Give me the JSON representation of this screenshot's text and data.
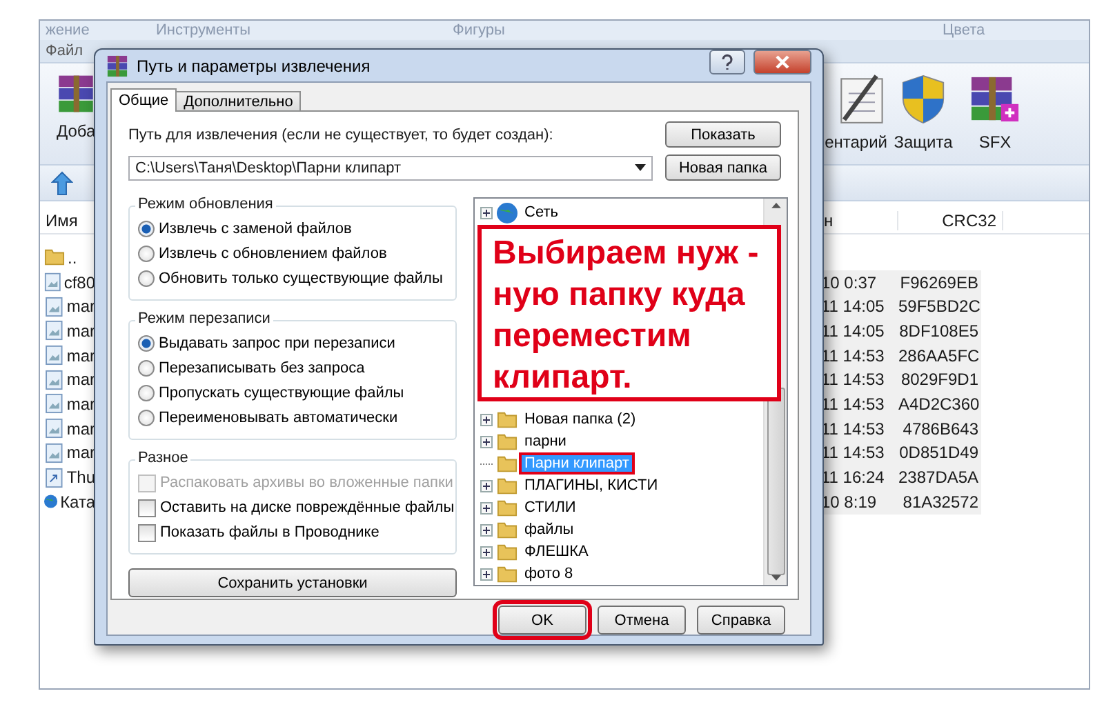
{
  "ribbon_groups": [
    "жение",
    "Инструменты",
    "Фигуры",
    "Цвета"
  ],
  "menu": [
    "Файл"
  ],
  "toolbar": [
    {
      "kind": "archive",
      "label": "Доба"
    },
    {
      "kind": "comment",
      "label": "ентарий"
    },
    {
      "kind": "shield",
      "label": "Защита"
    },
    {
      "kind": "sfx",
      "label": "SFX"
    }
  ],
  "file_list": {
    "columns": [
      "Имя",
      "н",
      "CRC32"
    ],
    "rows": [
      {
        "kind": "folder",
        "name": ".."
      },
      {
        "kind": "image",
        "name": "cf80",
        "modified": "10 0:37",
        "crc": "F96269EB"
      },
      {
        "kind": "image",
        "name": "mar",
        "modified": "11 14:05",
        "crc": "59F5BD2C"
      },
      {
        "kind": "image",
        "name": "mar",
        "modified": "11 14:05",
        "crc": "8DF108E5"
      },
      {
        "kind": "image",
        "name": "mar",
        "modified": "11 14:53",
        "crc": "286AA5FC"
      },
      {
        "kind": "image",
        "name": "mar",
        "modified": "11 14:53",
        "crc": "8029F9D1"
      },
      {
        "kind": "image",
        "name": "mar",
        "modified": "11 14:53",
        "crc": "A4D2C360"
      },
      {
        "kind": "image",
        "name": "mar",
        "modified": "11 14:53",
        "crc": "4786B643"
      },
      {
        "kind": "image",
        "name": "mar",
        "modified": "11 14:53",
        "crc": "0D851D49"
      },
      {
        "kind": "shortcut",
        "name": "Thu",
        "modified": "11 16:24",
        "crc": "2387DA5A"
      },
      {
        "kind": "globe",
        "name": "Ката",
        "modified": "10 8:19",
        "crc": "81A32572"
      }
    ]
  },
  "dialog": {
    "title": "Путь и параметры извлечения",
    "tabs": [
      {
        "label": "Общие",
        "selected": true
      },
      {
        "label": "Дополнительно",
        "selected": false
      }
    ],
    "path_label": "Путь для извлечения (если не существует, то будет создан):",
    "path_value": "C:\\Users\\Таня\\Desktop\\Парни клипарт",
    "side_buttons": [
      "Показать",
      "Новая папка"
    ],
    "groups": [
      {
        "title": "Режим обновления",
        "options": [
          {
            "kind": "radio",
            "label": "Извлечь с заменой файлов",
            "selected": true,
            "disabled": false
          },
          {
            "kind": "radio",
            "label": "Извлечь с обновлением файлов",
            "selected": false,
            "disabled": false
          },
          {
            "kind": "radio",
            "label": "Обновить только существующие файлы",
            "selected": false,
            "disabled": false
          }
        ]
      },
      {
        "title": "Режим перезаписи",
        "options": [
          {
            "kind": "radio",
            "label": "Выдавать запрос при перезаписи",
            "selected": true,
            "disabled": false
          },
          {
            "kind": "radio",
            "label": "Перезаписывать без запроса",
            "selected": false,
            "disabled": false
          },
          {
            "kind": "radio",
            "label": "Пропускать существующие файлы",
            "selected": false,
            "disabled": false
          },
          {
            "kind": "radio",
            "label": "Переименовывать автоматически",
            "selected": false,
            "disabled": false
          }
        ]
      },
      {
        "title": "Разное",
        "options": [
          {
            "kind": "checkbox",
            "label": "Распаковать архивы во вложенные папки",
            "selected": false,
            "disabled": true
          },
          {
            "kind": "checkbox",
            "label": "Оставить на диске повреждённые файлы",
            "selected": false,
            "disabled": false
          },
          {
            "kind": "checkbox",
            "label": "Показать файлы в Проводнике",
            "selected": false,
            "disabled": false
          }
        ]
      }
    ],
    "save_button": "Сохранить установки",
    "tree_top": [
      {
        "kind": "network",
        "label": "Сеть",
        "expandable": true,
        "selected": false
      }
    ],
    "tree": [
      {
        "kind": "folder",
        "label": "Новая папка (2)",
        "expandable": true,
        "selected": false,
        "highlighted": false
      },
      {
        "kind": "folder",
        "label": "парни",
        "expandable": true,
        "selected": false,
        "highlighted": false
      },
      {
        "kind": "folder",
        "label": "Парни клипарт",
        "expandable": false,
        "selected": true,
        "highlighted": true
      },
      {
        "kind": "folder",
        "label": "ПЛАГИНЫ, КИСТИ",
        "expandable": true,
        "selected": false,
        "highlighted": false
      },
      {
        "kind": "folder",
        "label": "СТИЛИ",
        "expandable": true,
        "selected": false,
        "highlighted": false
      },
      {
        "kind": "folder",
        "label": "файлы",
        "expandable": true,
        "selected": false,
        "highlighted": false
      },
      {
        "kind": "folder",
        "label": "ФЛЕШКА",
        "expandable": true,
        "selected": false,
        "highlighted": false
      },
      {
        "kind": "folder",
        "label": "фото 8",
        "expandable": true,
        "selected": false,
        "highlighted": false
      }
    ],
    "callout": {
      "lines": [
        "Выбираем нуж -",
        "ную папку куда",
        "переместим",
        "клипарт."
      ]
    },
    "buttons": [
      {
        "label": "OK",
        "highlighted": true
      },
      {
        "label": "Отмена",
        "highlighted": false
      },
      {
        "label": "Справка",
        "highlighted": false
      }
    ]
  }
}
